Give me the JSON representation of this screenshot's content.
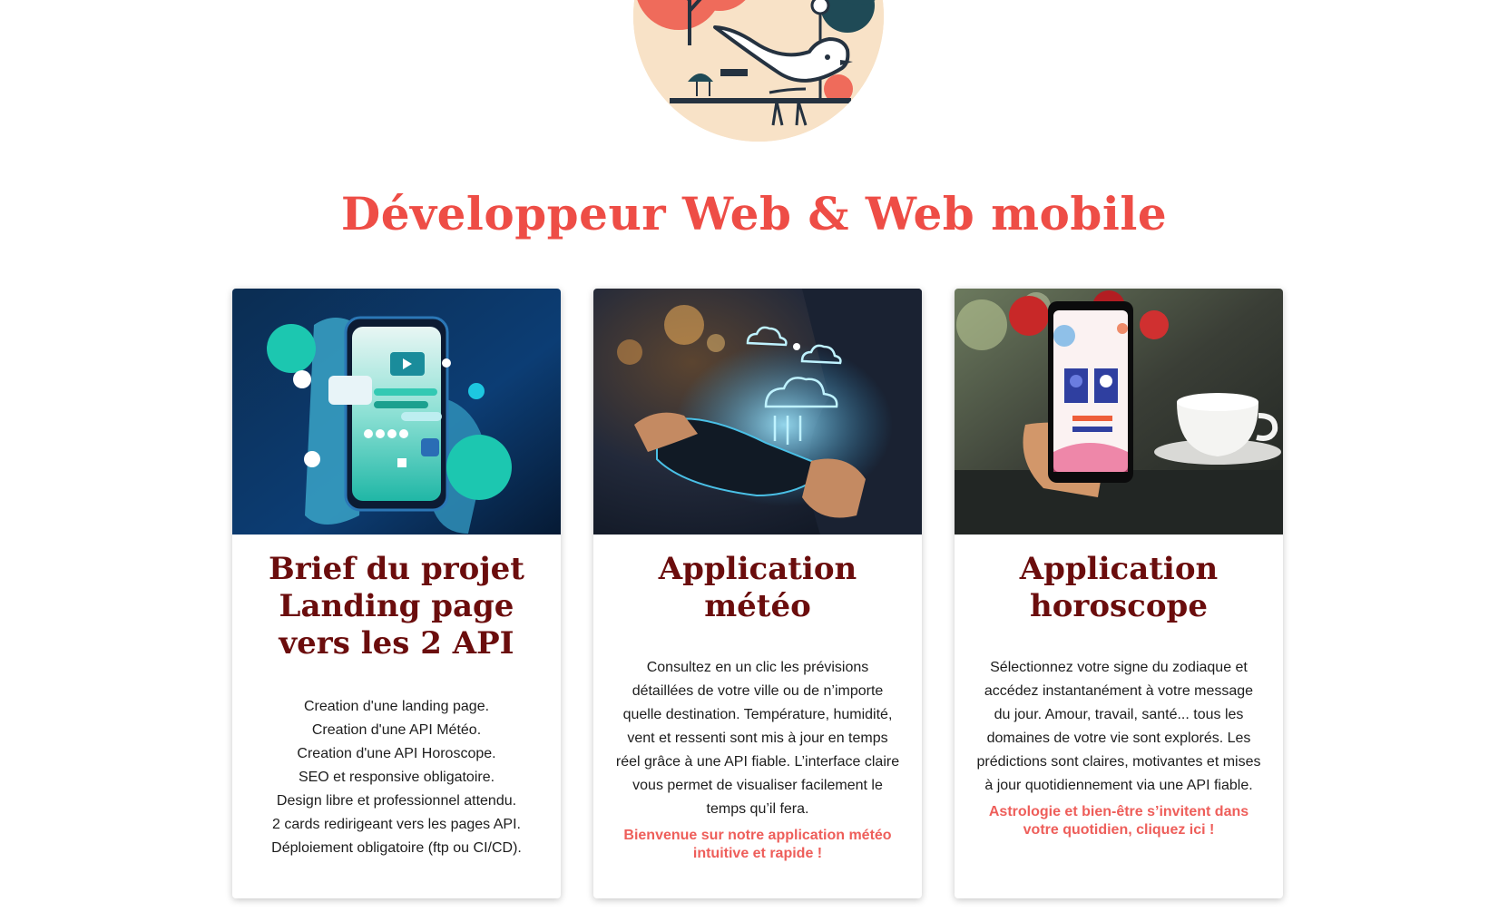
{
  "page": {
    "title": "Développeur Web & Web mobile"
  },
  "logo": {
    "icon": "bird-logo-icon"
  },
  "colors": {
    "title": "#ee4d46",
    "card_title": "#6b0d0d",
    "cta": "#ee5e5a"
  },
  "cards": [
    {
      "image_icon": "phone-app-image",
      "title_lines": [
        "Brief du projet",
        "Landing page",
        "vers les 2 API"
      ],
      "items": [
        "Creation d'une landing page.",
        "Creation d'une API Météo.",
        "Creation d'une API Horoscope.",
        "SEO et responsive obligatoire.",
        "Design libre et professionnel attendu.",
        "2 cards redirigeant vers les pages API.",
        "Déploiement obligatoire (ftp ou CI/CD)."
      ]
    },
    {
      "image_icon": "weather-cloud-image",
      "title_lines": [
        "Application",
        "météo"
      ],
      "text": "Consultez en un clic les prévisions détaillées de votre ville ou de n’importe quelle destination. Température, humidité, vent et ressenti sont mis à jour en temps réel grâce à une API fiable. L’interface claire vous permet de visualiser facilement le temps qu’il fera.",
      "cta": "Bienvenue sur notre application météo intuitive et rapide !"
    },
    {
      "image_icon": "horoscope-phone-image",
      "title_lines": [
        "Application",
        "horoscope"
      ],
      "text": "Sélectionnez votre signe du zodiaque et accédez instantanément à votre message du jour. Amour, travail, santé... tous les domaines de votre vie sont explorés. Les prédictions sont claires, motivantes et mises à jour quotidiennement via une API fiable.",
      "cta": "Astrologie et bien-être s’invitent dans votre quotidien, cliquez ici !"
    }
  ]
}
